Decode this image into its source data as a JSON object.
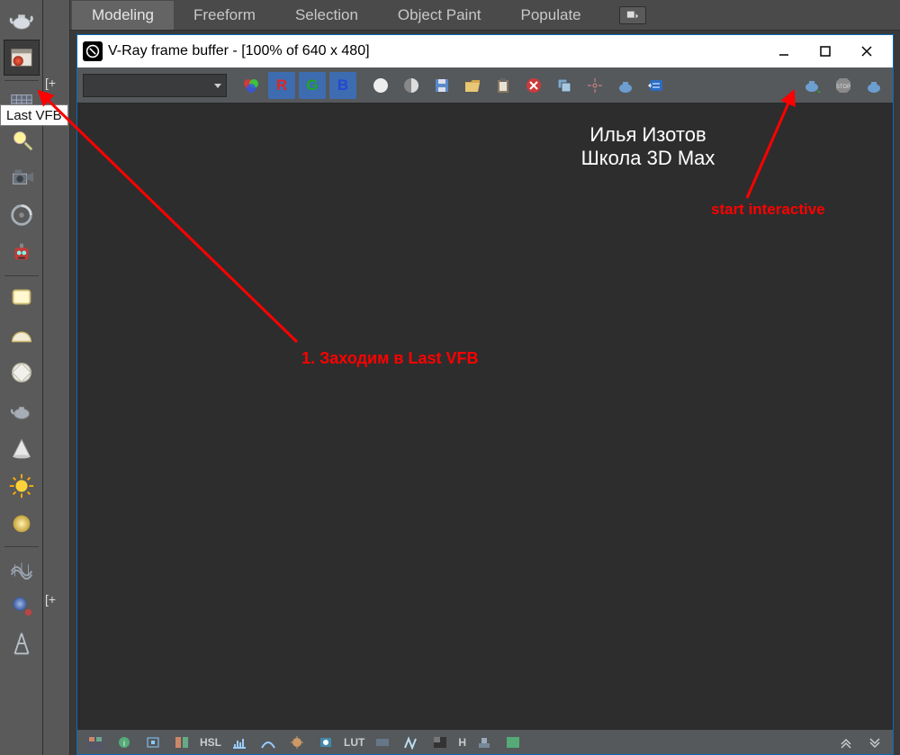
{
  "ribbon": {
    "tabs": [
      "Modeling",
      "Freeform",
      "Selection",
      "Object Paint",
      "Populate"
    ],
    "activeIndex": 0
  },
  "midstrip": {
    "bracket1": "[+",
    "bracket2": "[+"
  },
  "tooltip": "Last VFB",
  "vfb": {
    "title": "V-Ray frame buffer - [100% of 640 x 480]",
    "rgb": {
      "r": "R",
      "g": "G",
      "b": "B"
    },
    "bottomLabels": {
      "hsl": "HSL",
      "lut": "LUT",
      "h": "H"
    }
  },
  "overlay": {
    "author1": "Илья Изотов",
    "author2": "Школа 3D Max",
    "step1": "1. Заходим в Last VFB",
    "startInteractive": "start interactive"
  },
  "leftRailIcons": [
    "teapot",
    "vray-frame-buffer",
    "grid",
    "light",
    "camera",
    "physical-camera",
    "robot",
    "plane",
    "dome",
    "geo-dome",
    "teapot2",
    "cone",
    "sun",
    "sun-soft",
    "mesh",
    "proxy",
    "ies"
  ]
}
